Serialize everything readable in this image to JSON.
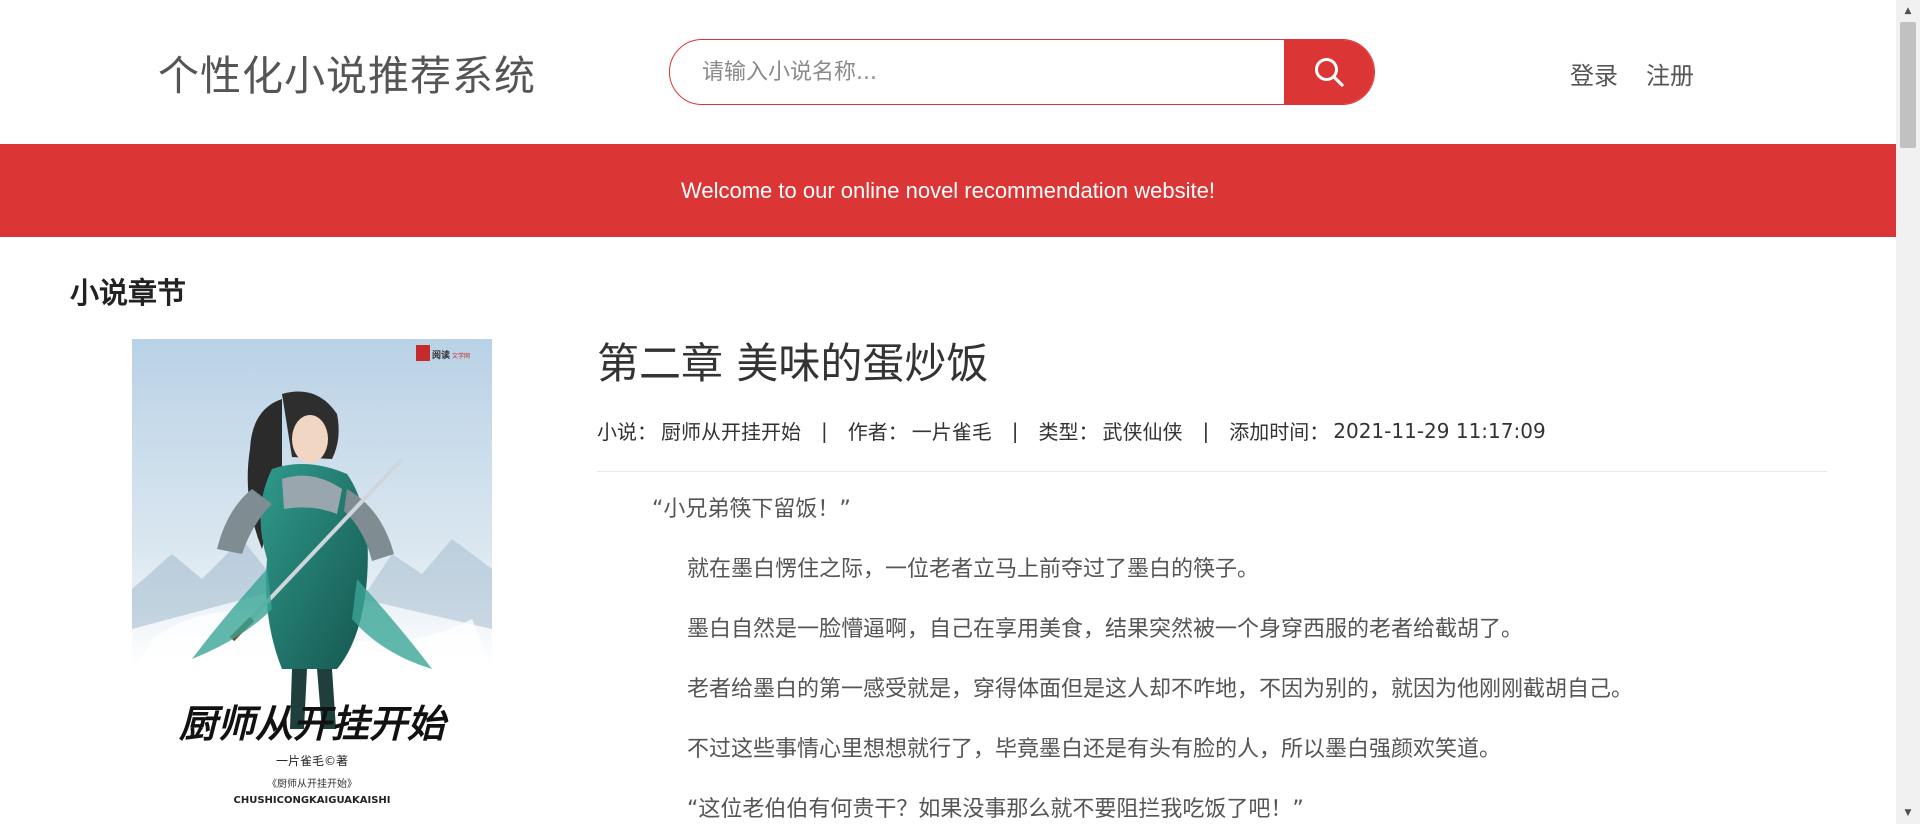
{
  "header": {
    "site_title": "个性化小说推荐系统",
    "search": {
      "placeholder": "请输入小说名称...",
      "value": ""
    },
    "nav": {
      "login": "登录",
      "register": "注册"
    }
  },
  "banner": {
    "text": "Welcome to our online novel recommendation website!"
  },
  "section": {
    "title": "小说章节"
  },
  "cover": {
    "title_art": "厨师从开挂开始",
    "author_line": "一片雀毛©著",
    "subtitle": "《厨师从开挂开始》",
    "pinyin": "CHUSHICONGKAIGUAKAISHI",
    "publisher_logo": "阅读",
    "publisher_text": "文学网"
  },
  "chapter": {
    "title": "第二章 美味的蛋炒饭",
    "meta": {
      "novel_label": "小说：",
      "novel": "厨师从开挂开始",
      "author_label": "作者：",
      "author": "一片雀毛",
      "genre_label": "类型：",
      "genre": "武侠仙侠",
      "time_label": "添加时间：",
      "time": "2021-11-29 11:17:09",
      "separator": "|"
    },
    "paragraphs": [
      "“小兄弟筷下留饭！”",
      "就在墨白愣住之际，一位老者立马上前夺过了墨白的筷子。",
      "墨白自然是一脸懵逼啊，自己在享用美食，结果突然被一个身穿西服的老者给截胡了。",
      "老者给墨白的第一感受就是，穿得体面但是这人却不咋地，不因为别的，就因为他刚刚截胡自己。",
      "不过这些事情心里想想就行了，毕竟墨白还是有头有脸的人，所以墨白强颜欢笑道。",
      "“这位老伯伯有何贵干？如果没事那么就不要阻拦我吃饭了吧！”"
    ]
  },
  "colors": {
    "accent": "#dc3535",
    "text": "#333333",
    "muted": "#555555"
  },
  "icons": {
    "search": "search-icon",
    "scroll_up": "arrow-up-icon",
    "scroll_down": "arrow-down-icon"
  }
}
